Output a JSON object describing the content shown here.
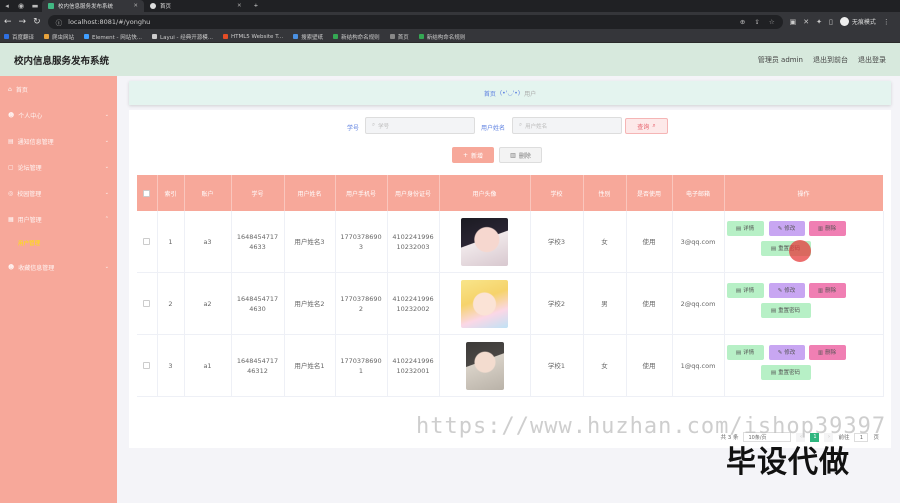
{
  "browser": {
    "tabs": [
      {
        "label": "校内信息服务发布系统",
        "active": true
      },
      {
        "label": "首页",
        "active": false
      }
    ],
    "new_tab": "+",
    "url": "localhost:8081/#/yonghu",
    "profile_label": "无痕模式",
    "bookmarks": [
      "百度翻译",
      "爬虫网站",
      "Element - 网站快...",
      "Layui - 经典开源模...",
      "HTML5 Website T...",
      "搜索壁纸",
      "新结构命名规则",
      "首页",
      "新结构命名规则"
    ]
  },
  "app": {
    "title": "校内信息服务发布系统",
    "header_links": [
      "管理员 admin",
      "退出到前台",
      "退出登录"
    ],
    "accent": "#f7a89a"
  },
  "sidebar": {
    "items": [
      {
        "label": "首页",
        "icon": "home-icon"
      },
      {
        "label": "个人中心",
        "icon": "user-icon"
      },
      {
        "label": "通知信息管理",
        "icon": "document-icon"
      },
      {
        "label": "论坛管理",
        "icon": "chat-icon"
      },
      {
        "label": "校园管理",
        "icon": "compass-icon"
      },
      {
        "label": "用户管理",
        "icon": "users-icon"
      }
    ],
    "sub_item": "用户管理",
    "last_item": {
      "label": "收藏信息管理",
      "icon": "user-icon"
    }
  },
  "breadcrumb": {
    "home": "首页",
    "separator": "(•'◡'•)",
    "current": "用户"
  },
  "search": {
    "field1_label": "学号",
    "field1_placeholder": "学号",
    "field2_label": "用户姓名",
    "field2_placeholder": "用户姓名",
    "button": "查询"
  },
  "actions": {
    "add": "新增",
    "delete": "删除"
  },
  "table": {
    "headers": [
      "索引",
      "账户",
      "学号",
      "用户姓名",
      "用户手机号",
      "用户身份证号",
      "用户头像",
      "学校",
      "性别",
      "是否使用",
      "电子邮箱",
      "操作"
    ],
    "rows": [
      {
        "index": "1",
        "account": "a3",
        "student_no": "16484547174633",
        "name": "用户姓名3",
        "phone": "17703786903",
        "id_card": "410224199610232003",
        "school": "学校3",
        "gender": "女",
        "in_use": "使用",
        "email": "3@qq.com"
      },
      {
        "index": "2",
        "account": "a2",
        "student_no": "16484547174630",
        "name": "用户姓名2",
        "phone": "17703786902",
        "id_card": "410224199610232002",
        "school": "学校2",
        "gender": "男",
        "in_use": "使用",
        "email": "2@qq.com"
      },
      {
        "index": "3",
        "account": "a1",
        "student_no": "164845471746312",
        "name": "用户姓名1",
        "phone": "17703786901",
        "id_card": "410224199610232001",
        "school": "学校1",
        "gender": "女",
        "in_use": "使用",
        "email": "1@qq.com"
      }
    ],
    "row_actions": {
      "detail": "详情",
      "edit": "修改",
      "delete": "删除",
      "reset": "重置密码"
    }
  },
  "pagination": {
    "total": "共 3 条",
    "page_size": "10条/页",
    "current_page": "1",
    "goto_label": "前往",
    "goto_value": "1",
    "page_suffix": "页"
  },
  "watermark": {
    "url": "https://www.huzhan.com/ishop39397",
    "text": "毕设代做"
  }
}
